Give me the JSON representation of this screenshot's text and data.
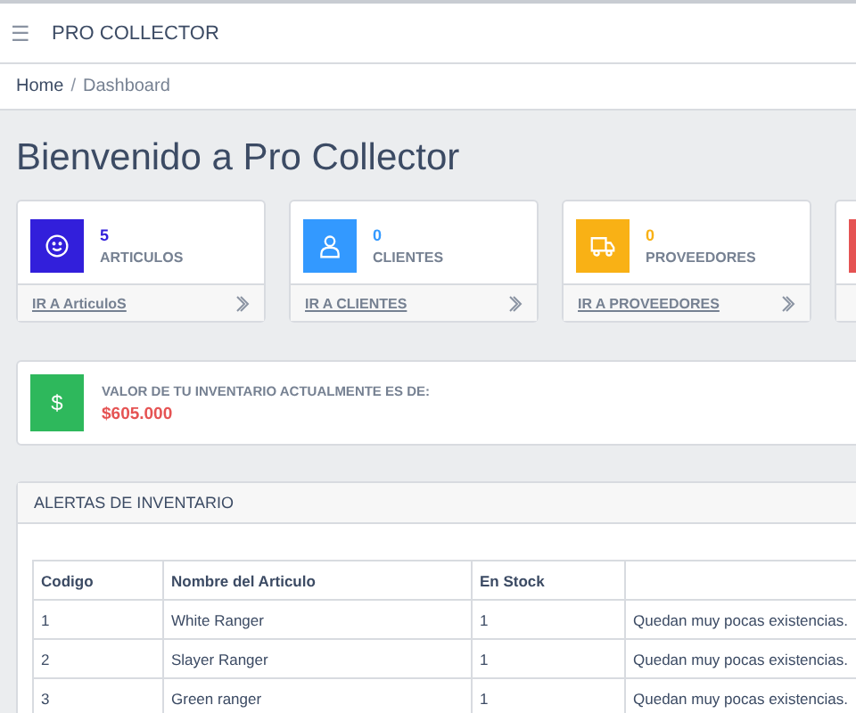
{
  "header": {
    "menu_icon": "☰",
    "title": "PRO COLLECTOR"
  },
  "breadcrumb": [
    {
      "label": "Home",
      "selected": false
    },
    {
      "label": "Dashboard",
      "selected": true
    }
  ],
  "breadcrumb_separator": "/",
  "page_title": "Bienvenido a Pro Collector",
  "stat_cards": [
    {
      "kind": "smiley",
      "color": "#321fdb",
      "count": "5",
      "label": "ARTICULOS",
      "link": "IR A ArticuloS"
    },
    {
      "kind": "user",
      "color": "#3399ff",
      "count": "0",
      "label": "CLIENTES",
      "link": "IR A CLIENTES"
    },
    {
      "kind": "truck",
      "color": "#f9b115",
      "count": "0",
      "label": "PROVEEDORES",
      "link": "IR A PROVEEDORES"
    },
    {
      "kind": "blank",
      "color": "#e55353"
    }
  ],
  "value_card": {
    "icon": "$",
    "label": "VALOR DE TU INVENTARIO ACTUALMENTE ES DE:",
    "value": "$605.000"
  },
  "alerts": {
    "title": "ALERTAS DE INVENTARIO",
    "columns": [
      "Codigo",
      "Nombre del Articulo",
      "En Stock",
      ""
    ],
    "rows": [
      [
        "1",
        "White Ranger",
        "1",
        "Quedan muy pocas existencias."
      ],
      [
        "2",
        "Slayer Ranger",
        "1",
        "Quedan muy pocas existencias."
      ],
      [
        "3",
        "Green ranger",
        "1",
        "Quedan muy pocas existencias."
      ]
    ]
  }
}
